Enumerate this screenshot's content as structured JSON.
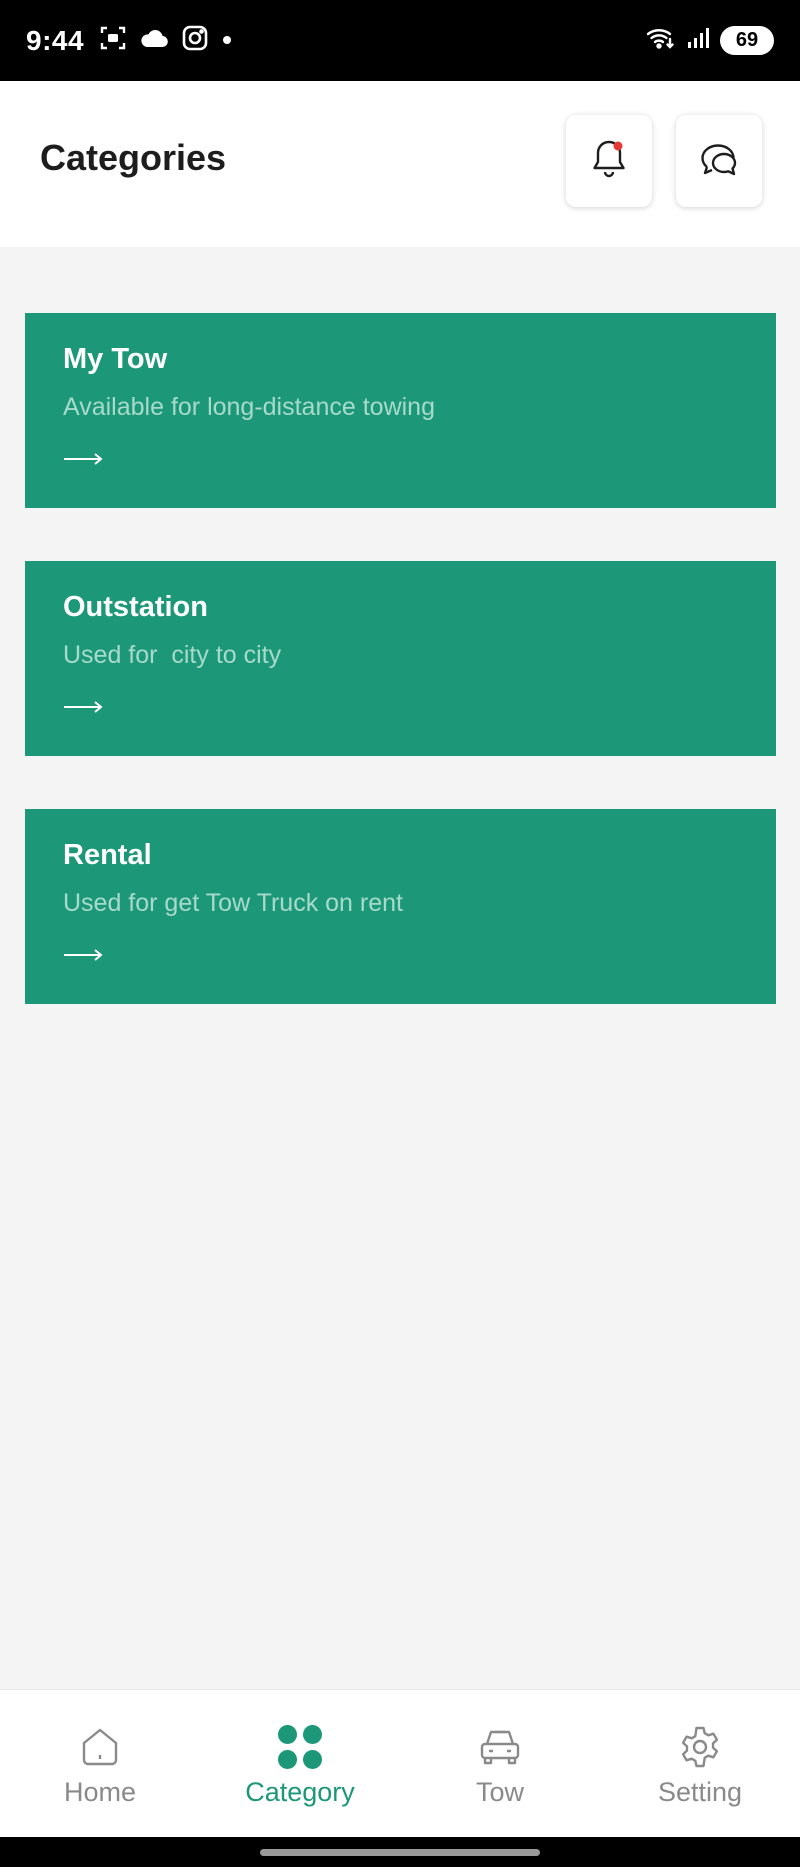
{
  "status_bar": {
    "time": "9:44",
    "battery": "69",
    "icons": [
      "screenshot-icon",
      "cloud-icon",
      "instagram-icon",
      "dot-icon",
      "wifi-icon",
      "signal-icon"
    ]
  },
  "header": {
    "title": "Categories",
    "notification_icon": "bell-icon",
    "chat_icon": "chat-icon",
    "notification_dot_color": "#e53935"
  },
  "categories": [
    {
      "title": "My Tow",
      "subtitle": "Available for long-distance towing"
    },
    {
      "title": "Outstation",
      "subtitle": "Used for  city to city"
    },
    {
      "title": "Rental",
      "subtitle": "Used for get Tow Truck on rent"
    }
  ],
  "bottom_nav": {
    "items": [
      {
        "label": "Home",
        "icon": "home-icon",
        "active": false
      },
      {
        "label": "Category",
        "icon": "grid-icon",
        "active": true
      },
      {
        "label": "Tow",
        "icon": "car-icon",
        "active": false
      },
      {
        "label": "Setting",
        "icon": "gear-icon",
        "active": false
      }
    ]
  },
  "colors": {
    "accent": "#1c9878",
    "background": "#f4f4f4",
    "inactive": "#8a8a8a"
  }
}
